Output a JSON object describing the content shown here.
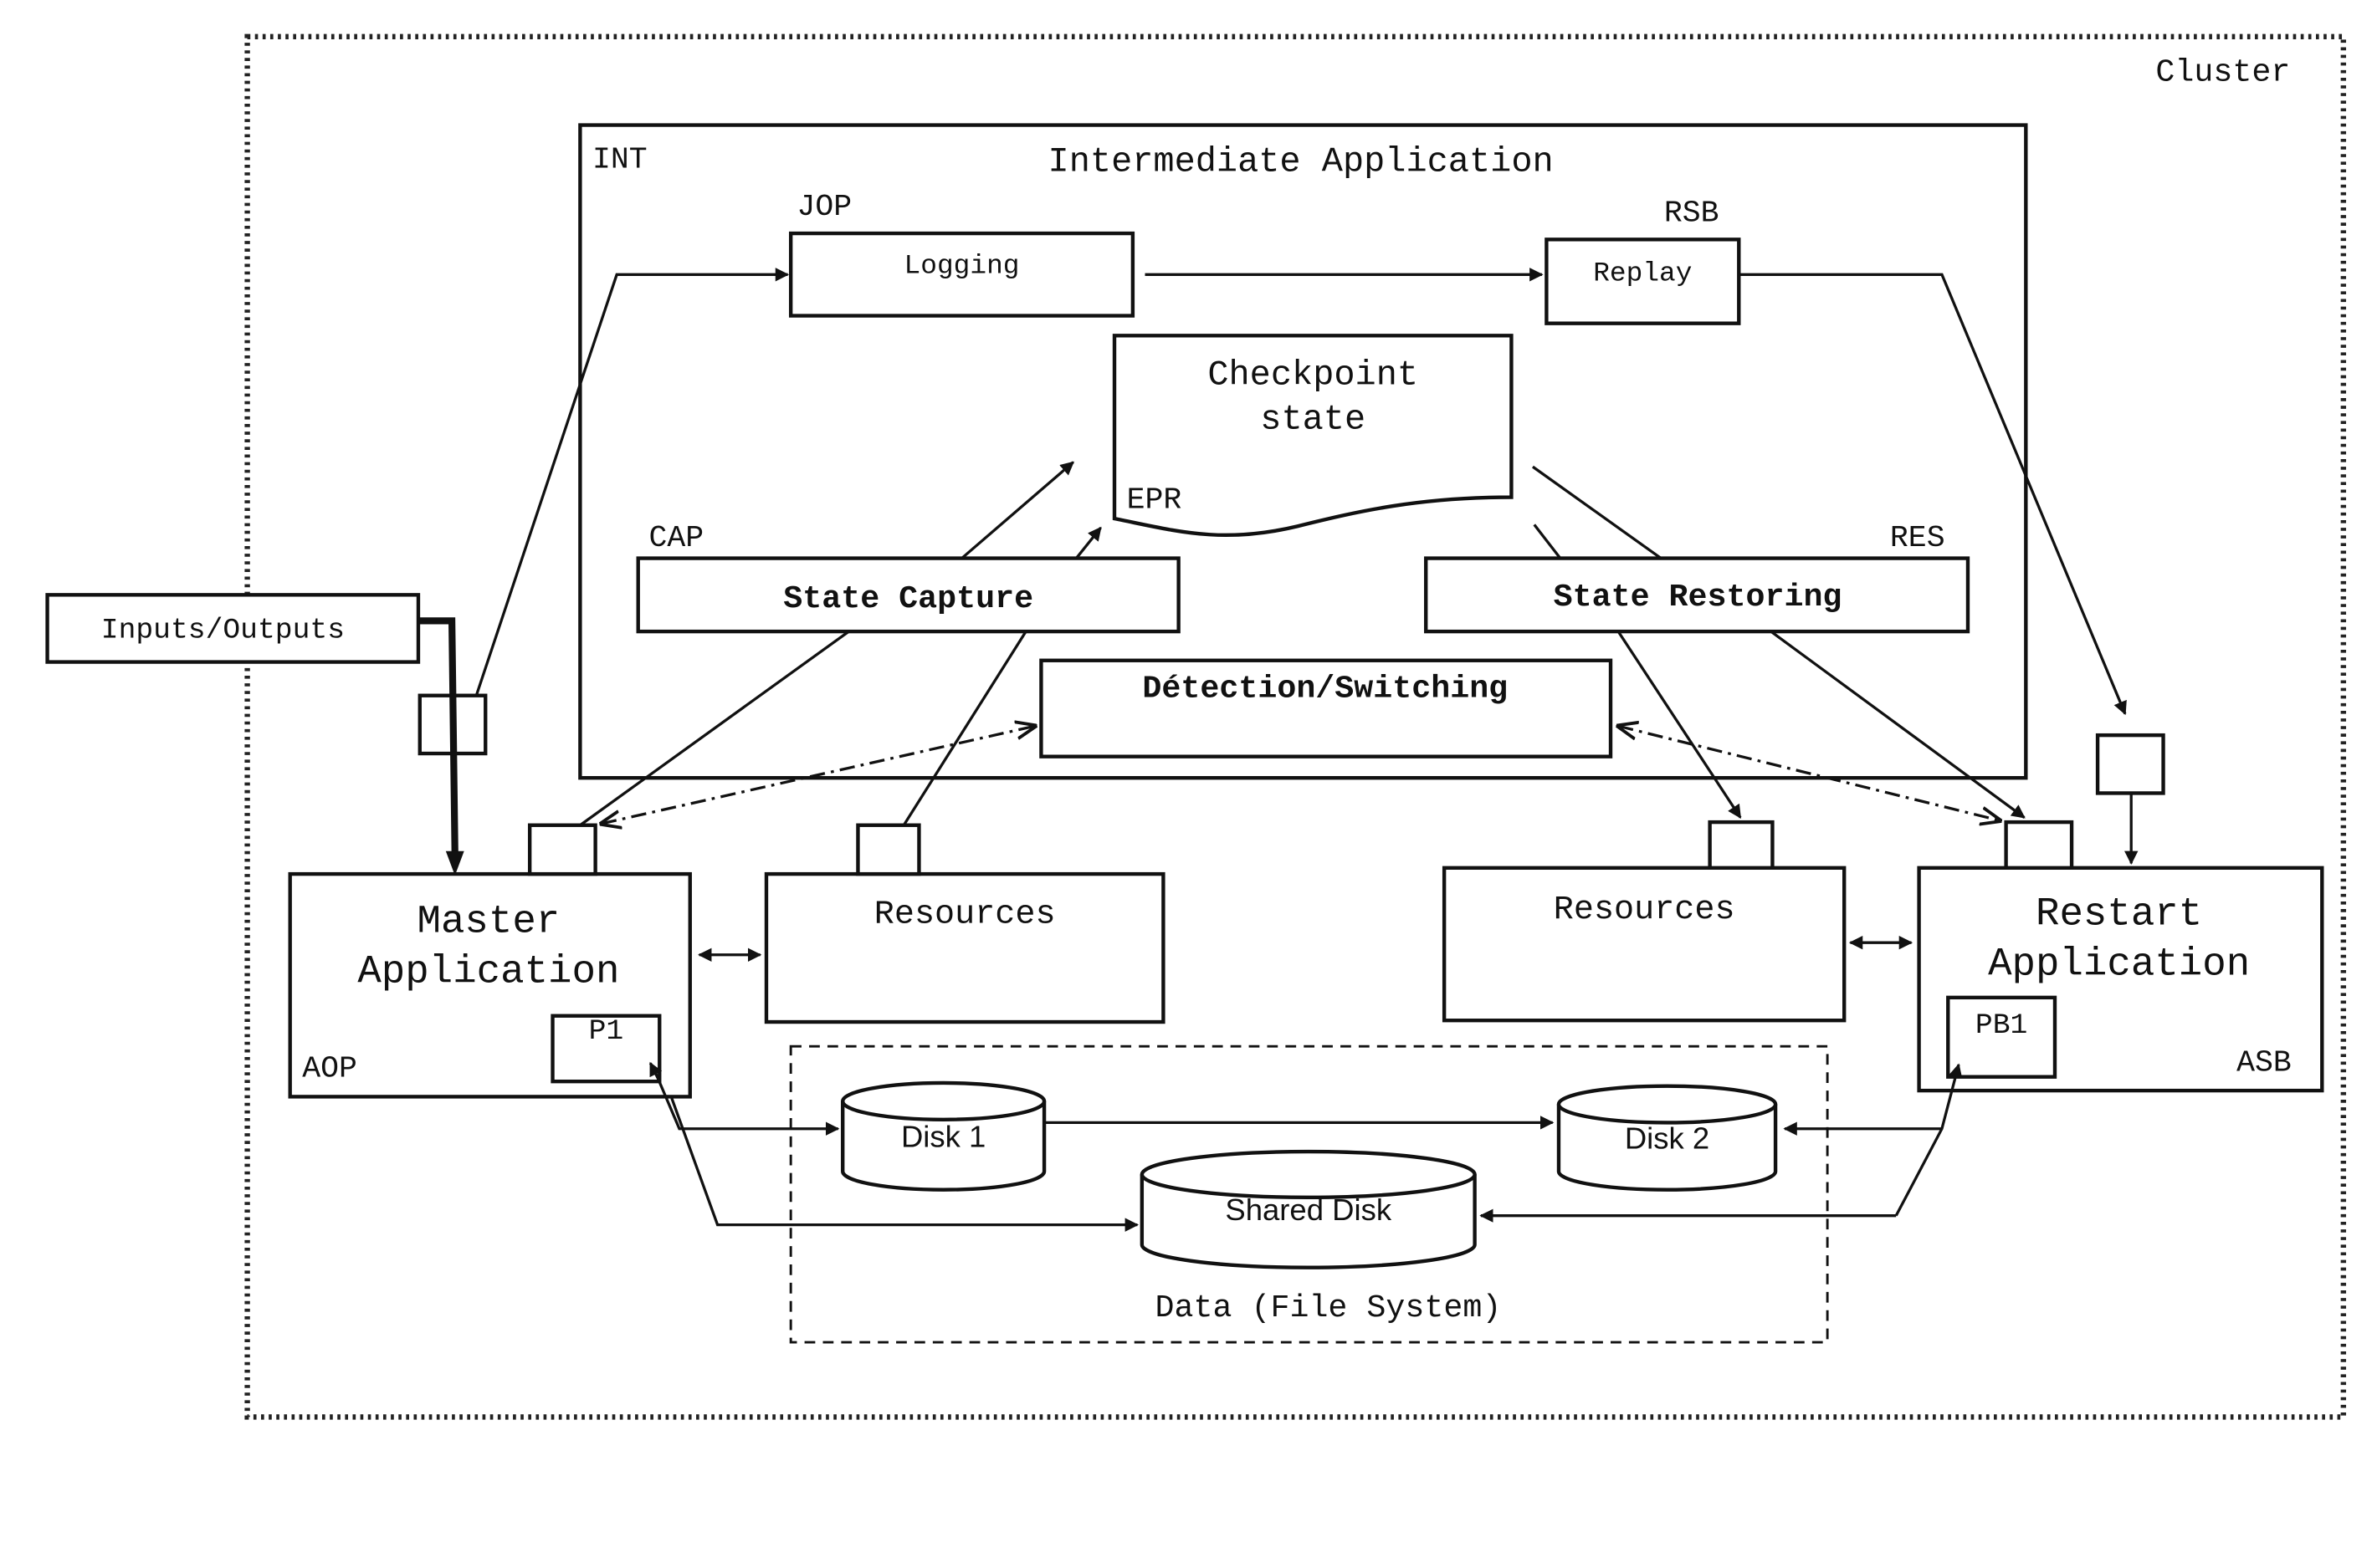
{
  "cluster": {
    "label": "Cluster"
  },
  "intermediate": {
    "tag": "INT",
    "title": "Intermediate Application",
    "logging": {
      "tag": "JOP",
      "label": "Logging"
    },
    "replay": {
      "tag": "RSB",
      "label": "Replay"
    },
    "checkpoint": {
      "line1": "Checkpoint",
      "line2": "state",
      "tag": "EPR"
    },
    "capture": {
      "tag": "CAP",
      "label": "State Capture"
    },
    "restoring": {
      "tag": "RES",
      "label": "State Restoring"
    },
    "detection": {
      "label": "Détection/Switching"
    }
  },
  "io": {
    "label": "Inputs/Outputs"
  },
  "master": {
    "line1": "Master",
    "line2": "Application",
    "tag": "AOP",
    "process": "P1"
  },
  "restart": {
    "line1": "Restart",
    "line2": "Application",
    "tag": "ASB",
    "process": "PB1"
  },
  "resources_left": {
    "label": "Resources"
  },
  "resources_right": {
    "label": "Resources"
  },
  "data": {
    "label": "Data (File System)",
    "disk1": "Disk 1",
    "disk2": "Disk 2",
    "shared": "Shared Disk"
  }
}
